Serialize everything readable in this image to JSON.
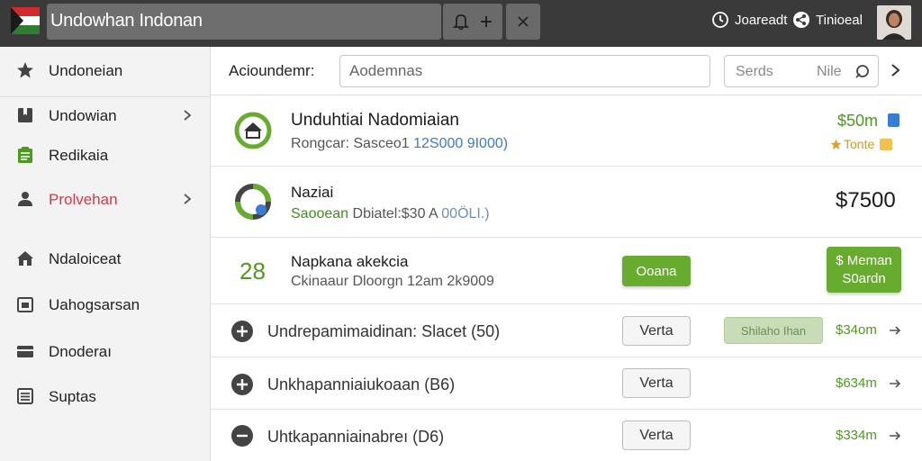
{
  "topbar": {
    "title": "Undowhan Indonan",
    "right_item_1": "Joareadt",
    "right_item_2": "Tinioeal"
  },
  "sidebar": {
    "items": [
      {
        "label": "Undoneian",
        "icon": "star-icon"
      },
      {
        "label": "Undowian",
        "icon": "bookmark-icon"
      },
      {
        "label": "Redikaia",
        "icon": "clipboard-icon"
      },
      {
        "label": "Prolvehan",
        "icon": "user-icon"
      },
      {
        "label": "Ndaloiceat",
        "icon": "home-icon"
      },
      {
        "label": "Uahogsarsan",
        "icon": "calendar-icon"
      },
      {
        "label": "Dnoderaı",
        "icon": "card-icon"
      },
      {
        "label": "Suptas",
        "icon": "list-icon"
      }
    ]
  },
  "header": {
    "label": "Acioundemr:",
    "input_value": "Aodemnas",
    "search_a": "Serds",
    "search_b": "Nile"
  },
  "rows": {
    "r1": {
      "title": "Unduhtiai Nadomiaian",
      "sub_prefix": "Rongcar: Sasceo1",
      "sub_blue": "12S000 9I000)",
      "price": "$50m",
      "tone": "Tonte"
    },
    "r2": {
      "title": "Naziai",
      "sub_green": "Saooean",
      "sub_mid": "Dbiatel:$30 A",
      "sub_blue": "00ÖLΙ.)",
      "price": "$7500"
    },
    "r3": {
      "number": "28",
      "title": "Napkana akekcia",
      "sub": "Ckinaaur Dloorgn 12am 2k9009",
      "button": "Ooana",
      "button2_line1": "$ Meman",
      "button2_line2": "S0ardn"
    }
  },
  "list": [
    {
      "title": "Undrepamimaidinan: Slacet (50)",
      "button": "Verta",
      "tag": "Shilaho Ihan",
      "price": "$34om"
    },
    {
      "title": "Unkhapanniaiukoaan (B6)",
      "button": "Verta",
      "price": "$634m"
    },
    {
      "title": "Uhtkapanniainabreı (D6)",
      "button": "Verta",
      "price": "$334m"
    }
  ],
  "colors": {
    "topbar": "#3a3a3a",
    "accent_green": "#67ab2f",
    "price_green": "#4e9a1e",
    "active_red": "#d03a4c",
    "link_blue": "#3a7bd5"
  }
}
